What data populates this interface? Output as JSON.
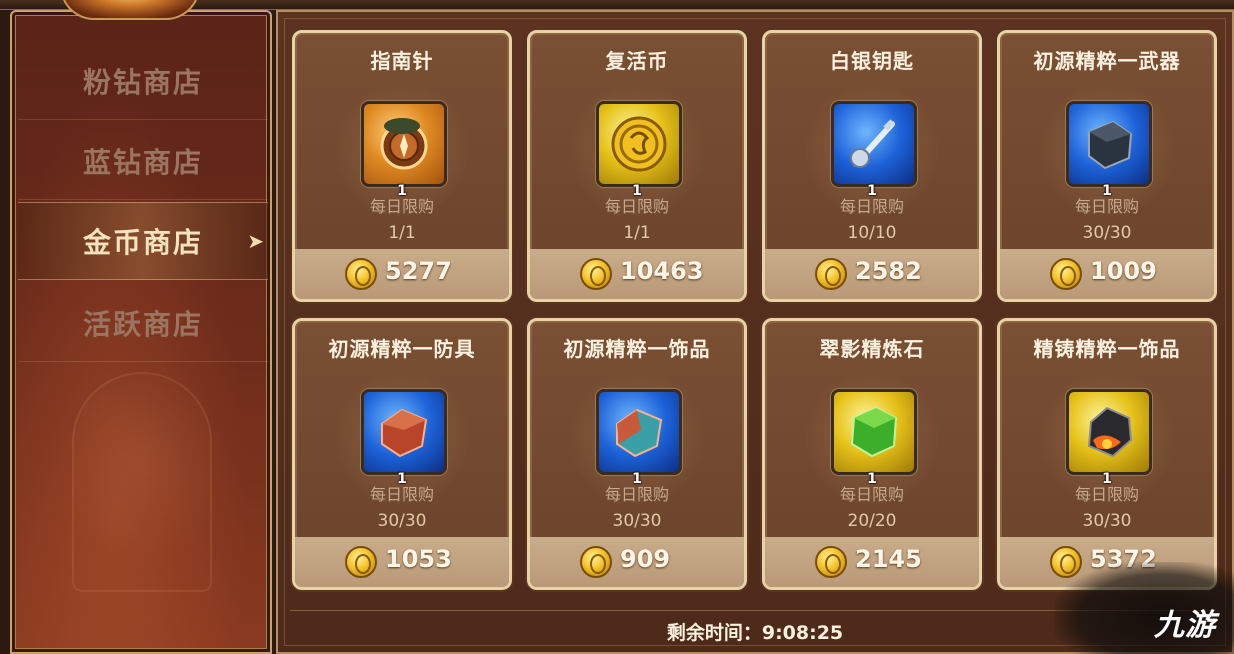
{
  "sidebar": {
    "items": [
      {
        "label": "粉钻商店",
        "active": false
      },
      {
        "label": "蓝钻商店",
        "active": false
      },
      {
        "label": "金币商店",
        "active": true
      },
      {
        "label": "活跃商店",
        "active": false
      }
    ]
  },
  "shop": {
    "limit_label": "每日限购",
    "items": [
      {
        "name": "指南针",
        "icon": "compass-icon",
        "bg": "orange",
        "qty": "1",
        "limit": "1/1",
        "price": "5277"
      },
      {
        "name": "复活币",
        "icon": "revive-coin-icon",
        "bg": "gold",
        "qty": "1",
        "limit": "1/1",
        "price": "10463"
      },
      {
        "name": "白银钥匙",
        "icon": "silver-key-icon",
        "bg": "blue",
        "qty": "1",
        "limit": "10/10",
        "price": "2582"
      },
      {
        "name": "初源精粹一武器",
        "icon": "weapon-essence-icon",
        "bg": "blue",
        "qty": "1",
        "limit": "30/30",
        "price": "1009"
      },
      {
        "name": "初源精粹一防具",
        "icon": "armor-essence-icon",
        "bg": "blue",
        "qty": "1",
        "limit": "30/30",
        "price": "1053"
      },
      {
        "name": "初源精粹一饰品",
        "icon": "accessory-essence-icon",
        "bg": "blue",
        "qty": "1",
        "limit": "30/30",
        "price": "909"
      },
      {
        "name": "翠影精炼石",
        "icon": "green-refine-stone-icon",
        "bg": "gold",
        "qty": "1",
        "limit": "20/20",
        "price": "2145"
      },
      {
        "name": "精铸精粹一饰品",
        "icon": "forged-essence-icon",
        "bg": "gold",
        "qty": "1",
        "limit": "30/30",
        "price": "5372"
      }
    ]
  },
  "timer": {
    "text": "剩余时间：9:08:25"
  },
  "watermark": {
    "text": "九游"
  },
  "colors": {
    "gold_border": "#e9d3a6",
    "panel_bg": "#5c3320",
    "sidebar_bg": "#6b2a1a"
  }
}
